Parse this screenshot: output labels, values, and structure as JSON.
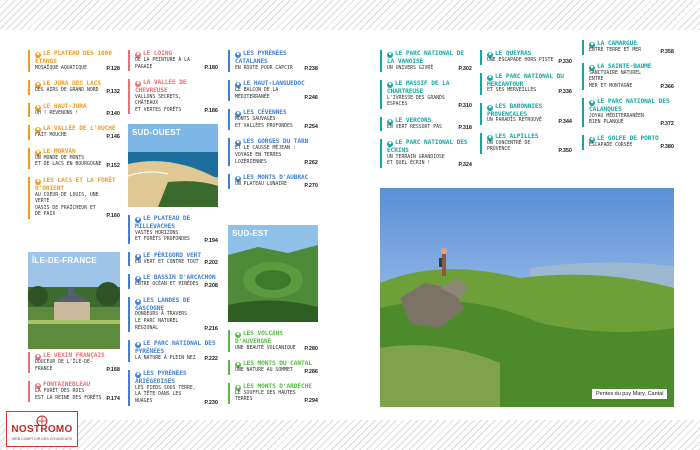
{
  "colors": {
    "orange": "#f39a1f",
    "pink": "#ee6e73",
    "blue": "#3f7fd9",
    "green": "#58b947",
    "teal": "#14a7a1",
    "lime": "#92c44b"
  },
  "logo": {
    "name": "NOSTROMO",
    "tagline": "WEB COMPTOIR DES VOYAGEURS",
    "icon": "ship-wheel-icon"
  },
  "caption": "Pentes du puy Mary, Cantal",
  "regions": {
    "sud_ouest": "SUD-OUEST",
    "ile_de_france": "ÎLE-DE-FRANCE",
    "sud_est": "SUD-EST"
  },
  "col1": [
    {
      "title": "Le plateau des 1000 étangs",
      "desc": "Mosaïque aquatique",
      "page": "P.128",
      "color": "orange"
    },
    {
      "title": "Le Jura des lacs",
      "desc": "Des airs de Grand Nord",
      "page": "P.132",
      "color": "orange"
    },
    {
      "title": "Le Haut-Jura",
      "desc": "Oh ! Revenons !",
      "page": "P.140",
      "color": "orange"
    },
    {
      "title": "La vallée de l'Ouche",
      "desc": "Fait mouche",
      "page": "P.146",
      "color": "orange"
    },
    {
      "title": "Le Morvan",
      "desc": "Un monde de monts\net de lacs en Bourgogne",
      "page": "P.152",
      "color": "orange"
    },
    {
      "title": "Les lacs et la forêt d'Orient",
      "desc": "Au coeur de Louis, une verte\noasis de fraîcheur et de paix",
      "page": "P.160",
      "color": "orange"
    }
  ],
  "col1b": [
    {
      "title": "Le Vexin français",
      "desc": "Douceur de l'Île-de-France",
      "page": "P.168",
      "color": "pink"
    },
    {
      "title": "Fontainebleau",
      "desc": "La forêt des rois\nest la reine des forêts",
      "page": "P.174",
      "color": "pink"
    }
  ],
  "col2a": [
    {
      "title": "Le Loing",
      "desc": "De la peinture à la pagaie",
      "page": "P.180",
      "color": "pink"
    },
    {
      "title": "La vallée de Chevreuse",
      "desc": "Vallons secrets, châteaux\net vertes forêts",
      "page": "P.186",
      "color": "pink"
    }
  ],
  "col2b": [
    {
      "title": "Le plateau de Millevaches",
      "desc": "Vastes horizons\net forêts profondes",
      "page": "P.194",
      "color": "blue"
    },
    {
      "title": "Le Périgord vert",
      "desc": "En vert et contre tout",
      "page": "P.202",
      "color": "blue"
    },
    {
      "title": "Le bassin d'Arcachon",
      "desc": "Entre océan et pinèdes",
      "page": "P.208",
      "color": "blue"
    },
    {
      "title": "Les landes de Gascogne",
      "desc": "Dondeurs à travers\nle parc naturel régional",
      "page": "P.216",
      "color": "blue"
    },
    {
      "title": "Le parc national des Pyrénées",
      "desc": "La nature à plein nez",
      "page": "P.222",
      "color": "blue"
    },
    {
      "title": "Les Pyrénées ariégeoises",
      "desc": "Les pieds sous terre,\nla tête dans les nuages",
      "page": "P.230",
      "color": "blue"
    }
  ],
  "col3a": [
    {
      "title": "Les Pyrénées catalanes",
      "desc": "En route pour Capcir",
      "page": "P.238",
      "color": "blue"
    },
    {
      "title": "Le Haut-Languedoc",
      "desc": "Le balcon de la Méditerranée",
      "page": "P.246",
      "color": "blue"
    },
    {
      "title": "Les Cévennes",
      "desc": "Monts sauvages\net vallées profondes",
      "page": "P.254",
      "color": "blue"
    },
    {
      "title": "Les gorges du Tarn",
      "desc": "Et le causse Méjean :\nvoyage en terres lozériennes",
      "page": "P.262",
      "color": "blue"
    },
    {
      "title": "Les monts d'Aubrac",
      "desc": "Un plateau lunaire",
      "page": "P.270",
      "color": "blue"
    }
  ],
  "col3b": [
    {
      "title": "Les volcans d'Auvergne",
      "desc": "Une beauté volcanique",
      "page": "P.280",
      "color": "green"
    },
    {
      "title": "Les monts du Cantal",
      "desc": "Une nature au sommet",
      "page": "P.286",
      "color": "green"
    },
    {
      "title": "Les monts d'Ardèche",
      "desc": "Le souffle des hautes terres",
      "page": "P.294",
      "color": "green"
    }
  ],
  "col4": [
    {
      "title": "Le parc national de la Vanoise",
      "desc": "Un univers givré",
      "page": "P.302",
      "color": "teal"
    },
    {
      "title": "Le massif de la Chartreuse",
      "desc": "L'ivresse des grands espaces",
      "page": "P.310",
      "color": "teal"
    },
    {
      "title": "Le Vercors",
      "desc": "En vert ressort pas",
      "page": "P.318",
      "color": "teal"
    },
    {
      "title": "Le parc national des Écrins",
      "desc": "Un terrain grandiose\net quel écrin !",
      "page": "P.324",
      "color": "teal"
    }
  ],
  "col5": [
    {
      "title": "Le Queyras",
      "desc": "Une escapade hors piste",
      "page": "P.330",
      "color": "teal"
    },
    {
      "title": "Le parc national du Mercantour",
      "desc": "Et ses merveilles",
      "page": "P.336",
      "color": "teal"
    },
    {
      "title": "Les Baronnies provençales",
      "desc": "Un paradis retrouvé",
      "page": "P.344",
      "color": "teal"
    },
    {
      "title": "Les Alpilles",
      "desc": "Un concentré de Provence",
      "page": "P.350",
      "color": "teal"
    }
  ],
  "col6": [
    {
      "title": "La Camargue",
      "desc": "Entre terre et mer",
      "page": "P.358",
      "color": "teal"
    },
    {
      "title": "La Sainte-Baume",
      "desc": "Sanctuaire naturel entre\nmer et montagne",
      "page": "P.366",
      "color": "teal"
    },
    {
      "title": "Le parc national des Calanques",
      "desc": "Joyau méditerranéen bien planqué",
      "page": "P.372",
      "color": "teal"
    },
    {
      "title": "Le golfe de Porto",
      "desc": "Escapade corsée",
      "page": "P.380",
      "color": "teal"
    }
  ]
}
